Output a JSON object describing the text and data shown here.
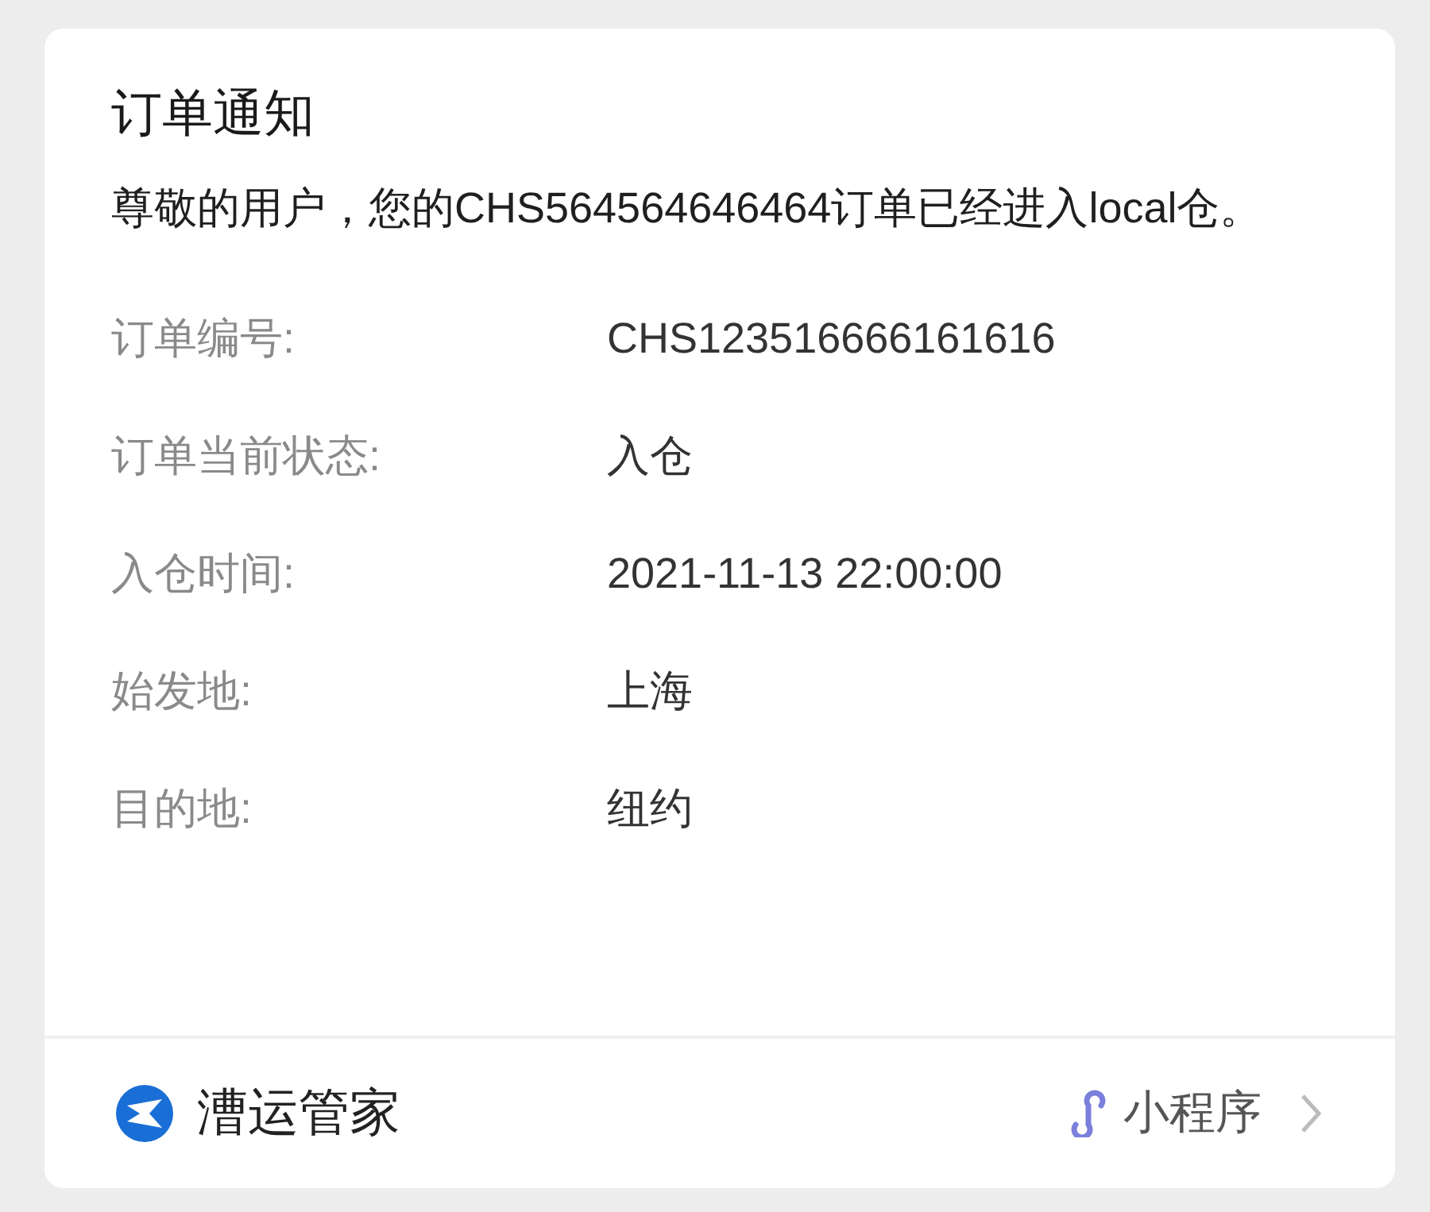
{
  "card": {
    "title": "订单通知",
    "message": "尊敬的用户，您的CHS564564646464订单已经进入local仓。",
    "fields": [
      {
        "label": "订单编号:",
        "value": "CHS123516666161616"
      },
      {
        "label": "订单当前状态:",
        "value": "入仓"
      },
      {
        "label": "入仓时间:",
        "value": "2021-11-13 22:00:00"
      },
      {
        "label": "始发地:",
        "value": "上海"
      },
      {
        "label": "目的地:",
        "value": "纽约"
      }
    ],
    "footer": {
      "app_name": "漕运管家",
      "link": "小程序"
    }
  }
}
